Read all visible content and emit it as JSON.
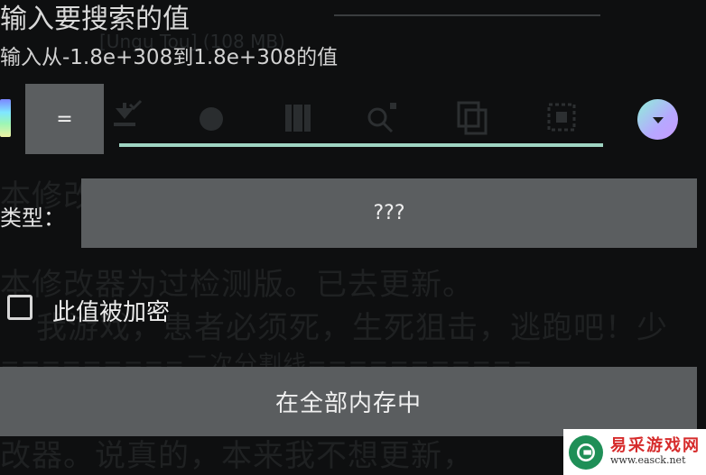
{
  "background_app": {
    "line1": "本修改",
    "line2": "本修改器为过检测版。已去更新。",
    "line3": "我游戏，患者必须死，生死狙击，逃跑吧！少",
    "line4": "=========二次分割线===========",
    "line5": "改器。说真的，本来我不想更新，",
    "ghost_hint": "[Ungu Tou] (108 MB)"
  },
  "dialog": {
    "title": "输入要搜索的值",
    "subtitle": "输入从-1.8e+308到1.8e+308的值",
    "toolbar": {
      "eq_label": "=",
      "icons": [
        "paste-icon",
        "circle-icon",
        "grid-icon",
        "history-search-icon",
        "copy-icon",
        "select-icon"
      ],
      "dropdown_icon": "chevron-down-icon"
    },
    "search_input": {
      "value": ""
    },
    "type_label": "类型：",
    "type_value": "???",
    "encrypted_label": "此值被加密",
    "encrypted_checked": false,
    "range_button_label": "在全部内存中"
  },
  "watermark": {
    "cn": "易采游戏网",
    "url": "www.easck.net"
  },
  "colors": {
    "background": "#0e0f10",
    "button_gray": "#5b5e60",
    "accent_underline": "#9fd4c2",
    "watermark_red": "#d62b2b",
    "watermark_green": "#1f8f57"
  }
}
